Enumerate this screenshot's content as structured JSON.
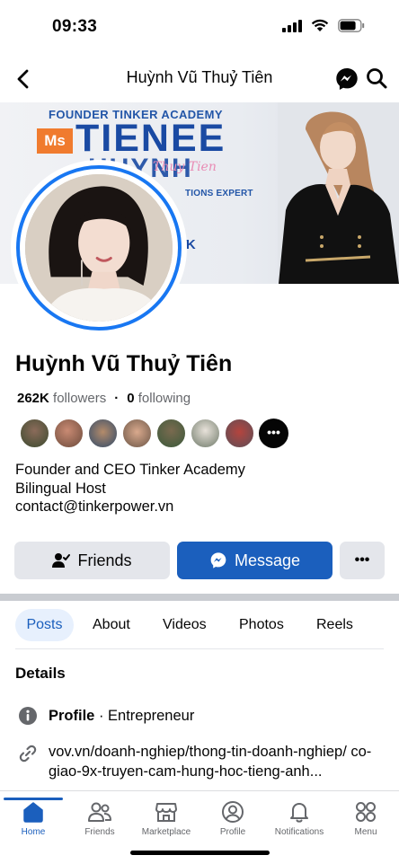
{
  "status": {
    "time": "09:33"
  },
  "nav": {
    "title": "Huỳnh Vũ Thuỷ Tiên"
  },
  "cover": {
    "line1": "FOUNDER TINKER ACADEMY",
    "badge": "Ms",
    "line2": "TIENEE",
    "line3": "HUYNH",
    "line4": "TIONS EXPERT",
    "chevrons": "KK"
  },
  "profile": {
    "name": "Huỳnh Vũ Thuỷ Tiên",
    "followers_count": "262K",
    "followers_label": "followers",
    "separator": "·",
    "following_count": "0",
    "following_label": "following",
    "friends_more": "•••",
    "bio": [
      "Founder and CEO Tinker Academy",
      "Bilingual Host",
      "contact@tinkerpower.vn"
    ]
  },
  "actions": {
    "friends_label": "Friends",
    "message_label": "Message",
    "more_label": "•••"
  },
  "tabs": [
    "Posts",
    "About",
    "Videos",
    "Photos",
    "Reels"
  ],
  "details": {
    "title": "Details",
    "profile_label": "Profile",
    "profile_value": " · Entrepreneur",
    "link": "vov.vn/doanh-nghiep/thong-tin-doanh-nghiep/ co-giao-9x-truyen-cam-hung-hoc-tieng-anh..."
  },
  "bottom_nav": [
    "Home",
    "Friends",
    "Marketplace",
    "Profile",
    "Notifications",
    "Menu"
  ],
  "colors": {
    "accent": "#1b5fbd",
    "facebook_blue": "#1877f2",
    "button_gray": "#e4e6eb"
  }
}
